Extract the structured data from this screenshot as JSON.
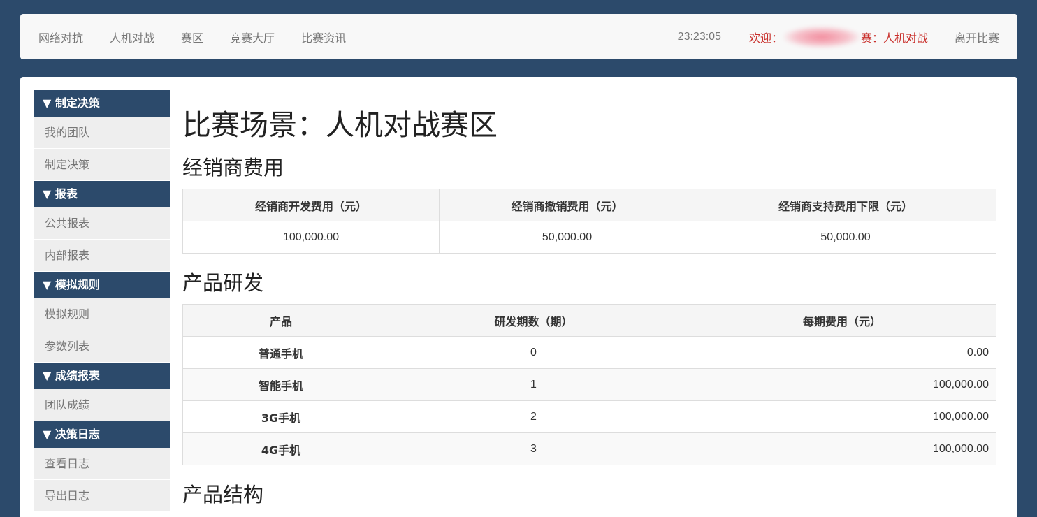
{
  "topnav": {
    "links": [
      "网络对抗",
      "人机对战",
      "赛区",
      "竞赛大厅",
      "比赛资讯"
    ],
    "clock": "23:23:05",
    "welcome_prefix": "欢迎：",
    "welcome_suffix": "赛：人机对战",
    "leave": "离开比赛"
  },
  "sidebar": {
    "groups": [
      {
        "header": "▼ 制定决策",
        "items": [
          "我的团队",
          "制定决策"
        ]
      },
      {
        "header": "▼ 报表",
        "items": [
          "公共报表",
          "内部报表"
        ]
      },
      {
        "header": "▼ 模拟规则",
        "items": [
          "模拟规则",
          "参数列表"
        ]
      },
      {
        "header": "▼ 成绩报表",
        "items": [
          "团队成绩"
        ]
      },
      {
        "header": "▼ 决策日志",
        "items": [
          "查看日志",
          "导出日志"
        ]
      }
    ]
  },
  "main": {
    "title": "比赛场景：人机对战赛区",
    "dealer_section": {
      "title": "经销商费用",
      "headers": [
        "经销商开发费用（元）",
        "经销商撤销费用（元）",
        "经销商支持费用下限（元）"
      ],
      "values": [
        "100,000.00",
        "50,000.00",
        "50,000.00"
      ]
    },
    "rd_section": {
      "title": "产品研发",
      "headers": [
        "产品",
        "研发期数（期）",
        "每期费用（元）"
      ],
      "rows": [
        {
          "product": "普通手机",
          "periods": "0",
          "cost": "0.00"
        },
        {
          "product": "智能手机",
          "periods": "1",
          "cost": "100,000.00"
        },
        {
          "product": "3G手机",
          "periods": "2",
          "cost": "100,000.00"
        },
        {
          "product": "4G手机",
          "periods": "3",
          "cost": "100,000.00"
        }
      ]
    },
    "structure_section": {
      "title": "产品结构"
    }
  },
  "colors": {
    "background": "#2c4a6b",
    "sidebar_header": "#2c4a6b",
    "welcome_text": "#c9302c"
  }
}
